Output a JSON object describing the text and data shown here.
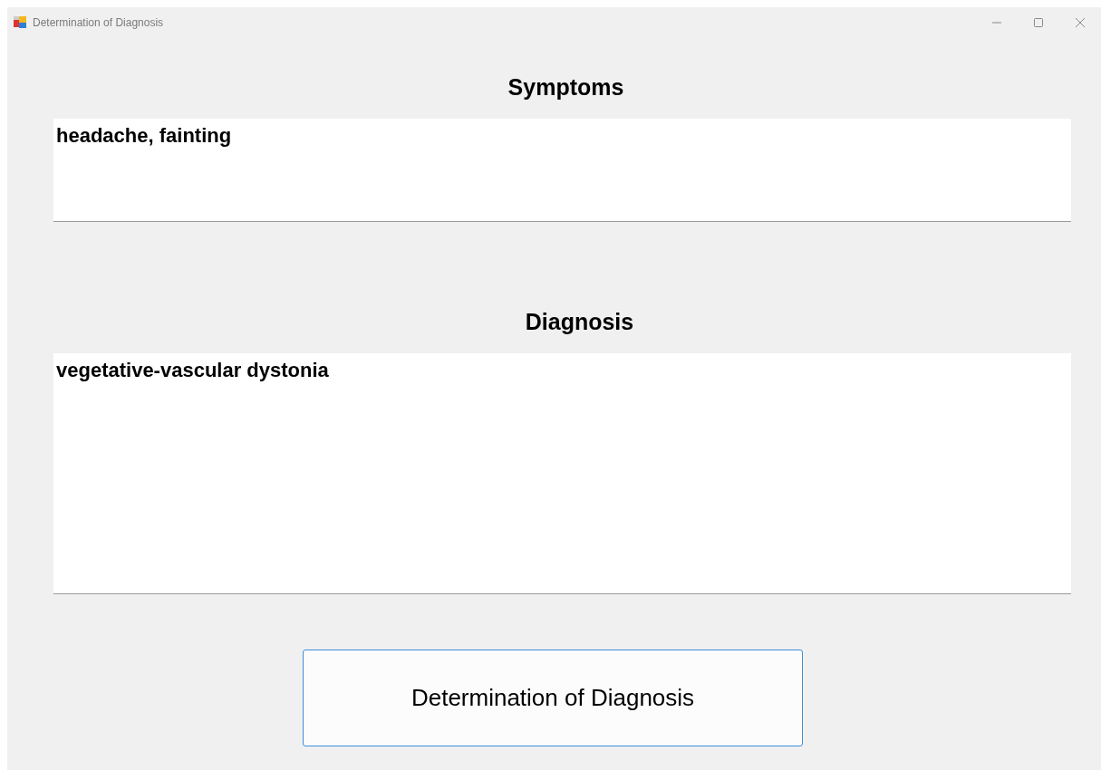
{
  "window": {
    "title": "Determination of Diagnosis"
  },
  "symptoms": {
    "label": "Symptoms",
    "value": "headache, fainting"
  },
  "diagnosis": {
    "label": "Diagnosis",
    "value": "vegetative-vascular dystonia"
  },
  "button": {
    "label": "Determination of Diagnosis"
  }
}
